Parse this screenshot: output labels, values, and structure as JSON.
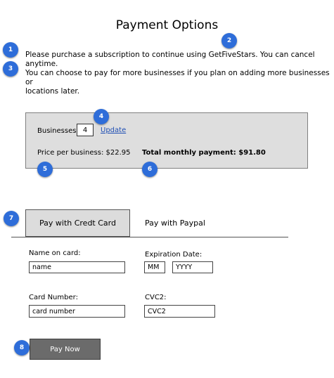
{
  "page": {
    "title": "Payment Options"
  },
  "intro": {
    "line1": "Please purchase a subscription to continue using GetFiveStars. You can cancel anytime.",
    "line2a": "You can choose to pay for more businesses if you plan on adding more businesses or",
    "line2b": "locations later."
  },
  "subscription": {
    "businesses_label": "Businesses:",
    "businesses_value": "4",
    "update_link": "Update",
    "price_per_business": "Price per business: $22.95",
    "total_monthly": "Total monthly payment: $91.80"
  },
  "tabs": {
    "credit_card": "Pay with Credt Card",
    "paypal": "Pay with Paypal"
  },
  "form": {
    "name_label": "Name on card:",
    "name_placeholder": "name",
    "expiration_label": "Expiration Date:",
    "month_placeholder": "MM",
    "year_placeholder": "YYYY",
    "card_number_label": "Card Number:",
    "card_number_placeholder": "card number",
    "cvc_label": "CVC2:",
    "cvc_placeholder": "CVC2"
  },
  "pay_button": "Pay Now",
  "annotations": [
    "1",
    "2",
    "3",
    "4",
    "5",
    "6",
    "7",
    "8"
  ],
  "colors": {
    "badge": "#2e6dd9",
    "link": "#1f4fb4",
    "button": "#6b6b6b",
    "panel": "#dedede"
  }
}
